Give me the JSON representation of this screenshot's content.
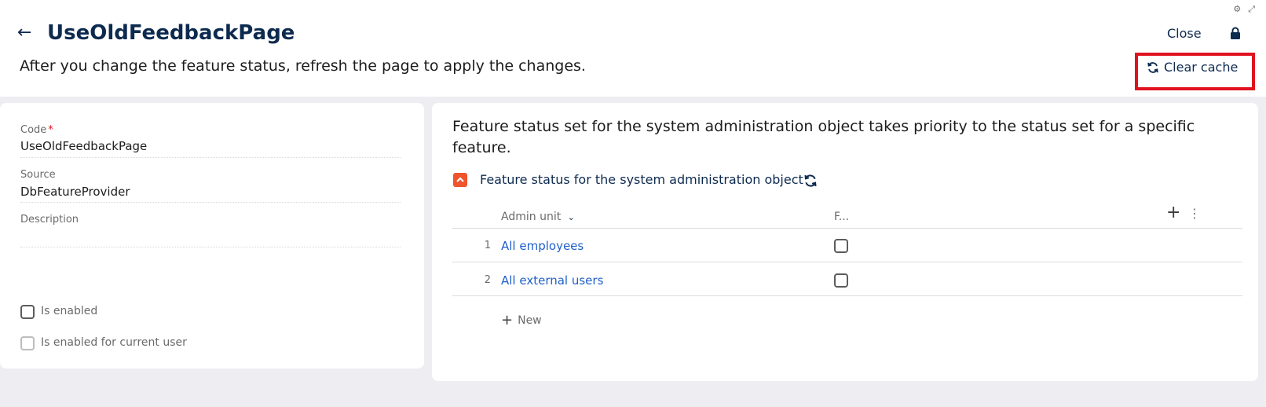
{
  "header": {
    "title": "UseOldFeedbackPage",
    "subtitle": "After you change the feature status, refresh the page to apply the changes.",
    "close_label": "Close",
    "clear_cache_label": "Clear cache"
  },
  "form": {
    "code_label": "Code",
    "code_value": "UseOldFeedbackPage",
    "source_label": "Source",
    "source_value": "DbFeatureProvider",
    "description_label": "Description",
    "description_value": "",
    "is_enabled_label": "Is enabled",
    "is_enabled_current_user_label": "Is enabled for current user"
  },
  "detail": {
    "info_text": "Feature status set for the system administration object takes priority to the status set for a specific feature.",
    "section_title": "Feature status for the system administration object",
    "columns": [
      "Admin unit",
      "F..."
    ],
    "rows": [
      {
        "num": "1",
        "name": "All employees"
      },
      {
        "num": "2",
        "name": "All external users"
      }
    ],
    "new_label": "New"
  },
  "colors": {
    "title": "#0d2a4f",
    "link": "#1f5fc9",
    "highlight": "#e0121f",
    "accent": "#f0542d"
  },
  "icons": [
    "back-arrow-icon",
    "settings-icon",
    "expand-icon",
    "lock-icon",
    "refresh-icon",
    "chevron-down-icon",
    "plus-icon",
    "kebab-icon",
    "collapse-icon"
  ]
}
